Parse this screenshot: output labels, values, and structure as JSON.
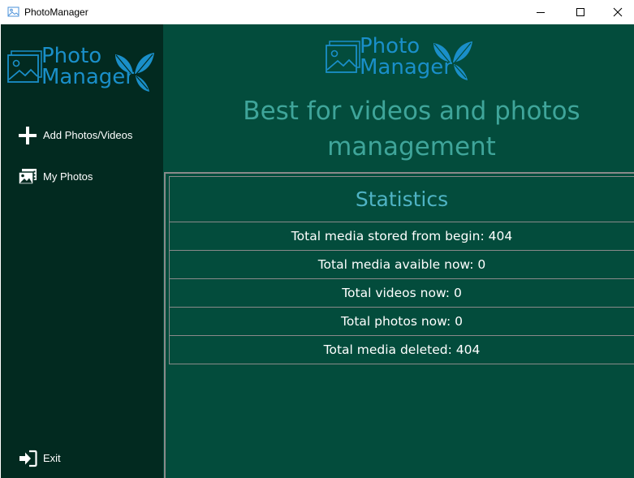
{
  "window": {
    "title": "PhotoManager",
    "controls": [
      "minimize-icon",
      "maximize-icon",
      "close-icon"
    ]
  },
  "logo": {
    "line1": "Photo",
    "line2": "Manager"
  },
  "sidebar": {
    "items": [
      {
        "label": "Add Photos/Videos",
        "icon": "plus-icon"
      },
      {
        "label": "My Photos",
        "icon": "photos-icon"
      }
    ],
    "exit": {
      "label": "Exit",
      "icon": "exit-icon"
    }
  },
  "main": {
    "headline_line1": "Best for videos and photos",
    "headline_line2": "management",
    "stats": {
      "title": "Statistics",
      "rows": [
        "Total media stored from begin: 404",
        "Total media avaible now: 0",
        "Total videos now: 0",
        "Total photos now: 0",
        "Total media deleted: 404"
      ]
    }
  },
  "colors": {
    "sidebar_bg": "#022a20",
    "main_bg": "#034c3c",
    "headline": "#3fa59a",
    "logo_blue": "#1a8fc9",
    "stats_title": "#4fb3c4",
    "border": "#8a8a8a"
  }
}
